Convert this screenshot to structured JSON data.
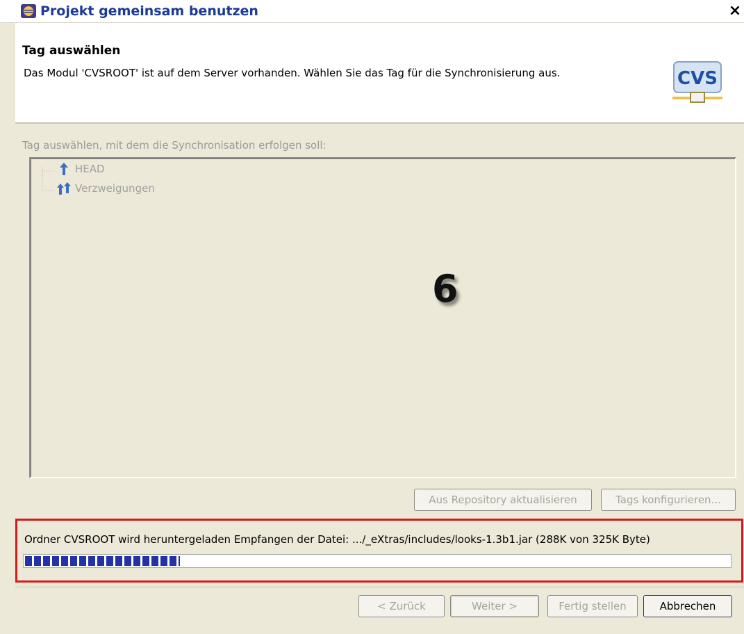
{
  "window": {
    "title": "Projekt gemeinsam benutzen",
    "close_label": "×"
  },
  "header": {
    "title": "Tag auswählen",
    "description": "Das Modul 'CVSROOT' ist auf dem Server vorhanden. Wählen Sie das Tag für die Synchronisierung aus.",
    "logo_text": "CVS"
  },
  "tag_group": {
    "label": "Tag auswählen, mit dem die Synchronisation erfolgen soll:",
    "items": [
      {
        "label": "HEAD",
        "icon": "head-tag-icon"
      },
      {
        "label": "Verzweigungen",
        "icon": "branches-icon"
      }
    ]
  },
  "overlay_number": "6",
  "buttons": {
    "refresh": "Aus Repository aktualisieren",
    "configure": "Tags konfigurieren..."
  },
  "status": {
    "text": "Ordner CVSROOT wird heruntergeladen Empfangen der Datei: .../_eXtras/includes/looks-1.3b1.jar (288K von 325K Byte)",
    "progress_fraction": 0.22
  },
  "footer": {
    "back": "< Zurück",
    "next": "Weiter >",
    "finish": "Fertig stellen",
    "cancel": "Abbrechen"
  },
  "colors": {
    "accent": "#1c3a96",
    "highlight_border": "#d41a1a",
    "progress": "#2432a8"
  }
}
